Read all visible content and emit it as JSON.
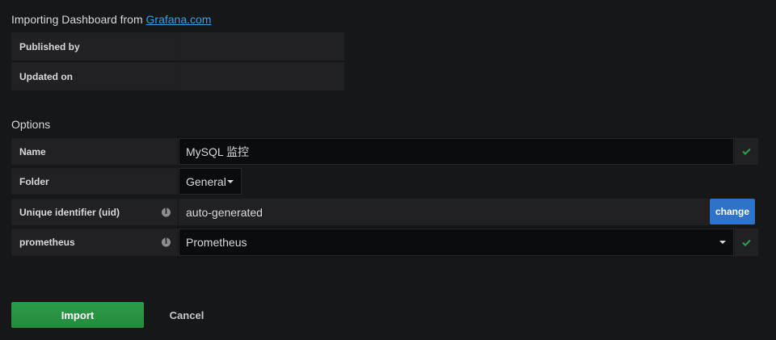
{
  "header": {
    "title_prefix": "Importing Dashboard from",
    "title_link": "Grafana.com"
  },
  "info": {
    "published_by_label": "Published by",
    "published_by_value": "",
    "updated_on_label": "Updated on",
    "updated_on_value": ""
  },
  "options": {
    "section_title": "Options",
    "name_label": "Name",
    "name_value": "MySQL 监控",
    "folder_label": "Folder",
    "folder_value": "General",
    "uid_label": "Unique identifier (uid)",
    "uid_value": "auto-generated",
    "uid_change_label": "change",
    "datasource_label": "prometheus",
    "datasource_value": "Prometheus"
  },
  "icons": {
    "info": "info-circle-icon",
    "check": "check-icon",
    "caret": "caret-down-icon"
  },
  "actions": {
    "import_label": "Import",
    "cancel_label": "Cancel"
  },
  "colors": {
    "background": "#161719",
    "accent_link": "#33a2e5",
    "success_check": "#299c46",
    "import_button": "#299c46",
    "change_button": "#2f73c9"
  }
}
